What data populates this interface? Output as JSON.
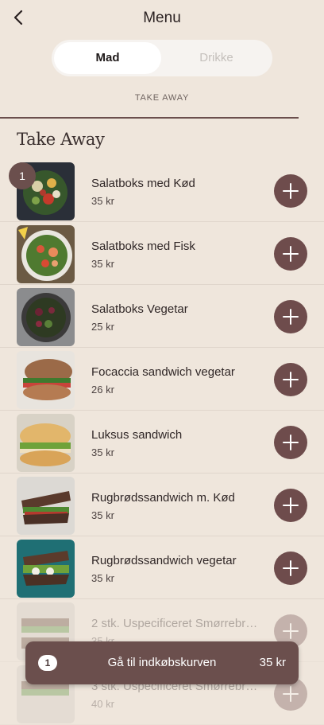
{
  "header": {
    "title": "Menu",
    "back_icon": "chevron-left-icon"
  },
  "segment": {
    "active": "Mad",
    "inactive": "Drikke"
  },
  "section_tab": "TAKE AWAY",
  "section_heading": "Take Away",
  "items": [
    {
      "name": "Salatboks med Kød",
      "price": "35 kr",
      "image": "salad-bowl-meat"
    },
    {
      "name": "Salatboks med Fisk",
      "price": "35 kr",
      "image": "salad-bowl-fish"
    },
    {
      "name": "Salatboks Vegetar",
      "price": "25 kr",
      "image": "salad-bowl-veg"
    },
    {
      "name": "Focaccia sandwich vegetar",
      "price": "26 kr",
      "image": "focaccia"
    },
    {
      "name": "Luksus sandwich",
      "price": "35 kr",
      "image": "luksus-sandwich"
    },
    {
      "name": "Rugbrødssandwich m. Kød",
      "price": "35 kr",
      "image": "rye-meat"
    },
    {
      "name": "Rugbrødssandwich vegetar",
      "price": "35 kr",
      "image": "rye-veg"
    },
    {
      "name": "2 stk. Uspecificeret Smørrebr…",
      "price": "35 kr",
      "image": "smorrebrod"
    },
    {
      "name": "3 stk. Uspecificeret Smørrebr…",
      "price": "40 kr",
      "image": "smorrebrod"
    }
  ],
  "first_item_qty": "1",
  "cart": {
    "count": "1",
    "label": "Gå til indkøbskurven",
    "total": "35 kr"
  },
  "colors": {
    "background": "#efe6dc",
    "accent": "#6b4f4d",
    "add_button": "#6e4c4c"
  }
}
